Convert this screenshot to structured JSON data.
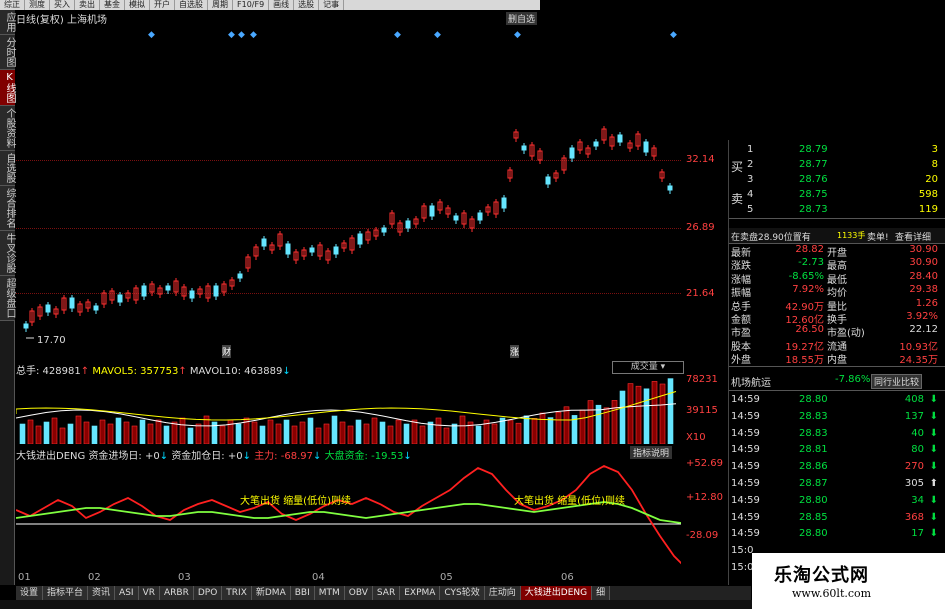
{
  "menu": [
    "综正",
    "测度",
    "买入",
    "卖出",
    "基金",
    "模拟",
    "开户",
    "自选股",
    "周期",
    "F10/F9",
    "画线",
    "选股",
    "记事"
  ],
  "left_tabs": [
    {
      "label": "应用",
      "active": false
    },
    {
      "label": "分时图",
      "active": false
    },
    {
      "label": "K线图",
      "active": true
    },
    {
      "label": "个股资料",
      "active": false
    },
    {
      "label": "自选股",
      "active": false
    },
    {
      "label": "综合排名",
      "active": false
    },
    {
      "label": "牛叉诊股",
      "active": false
    },
    {
      "label": "超级盘口",
      "active": false
    }
  ],
  "chart": {
    "title": "日线(复权) 上海机场",
    "delete_label": "删自选",
    "price_labels": [
      "32.14",
      "26.89",
      "21.64"
    ],
    "low_marker": "17.70",
    "markers": [
      "财",
      "涨"
    ]
  },
  "volume": {
    "total": "总手: 428981",
    "mavol5": "MAVOL5: 357753",
    "mavol10": "MAVOL10: 463889",
    "button": "成交量",
    "labels": [
      "78231",
      "39115",
      "X10"
    ]
  },
  "indicator": {
    "name": "大钱进出DENG",
    "inflow_days": "资金进场日: +0",
    "add_days": "资金加仓日: +0",
    "main": "主力: -68.97",
    "market": "大盘资金: -19.53",
    "button": "指标说明",
    "labels": [
      "+52.69",
      "+12.80",
      "-28.09"
    ],
    "text_a1": "大笔出货",
    "text_a2": "缩量(低位)则续",
    "text_b1": "大笔出货",
    "text_b2": "缩量(低位)则续"
  },
  "x_axis": [
    "01",
    "02",
    "03",
    "04",
    "05",
    "06"
  ],
  "bottom_tabs": [
    "设置",
    "指标平台",
    "资讯",
    "ASI",
    "VR",
    "ARBR",
    "DPO",
    "TRIX",
    "新DMA",
    "BBI",
    "MTM",
    "OBV",
    "SAR",
    "EXPMA",
    "CYS轮效",
    "庄动向",
    "大钱进出DENG",
    "细"
  ],
  "bottom_selected": 16,
  "quote": {
    "sell_label": "卖",
    "buy_label": "买",
    "sell_levels": [
      {
        "n": "1",
        "p": "28.79",
        "v": "3"
      },
      {
        "n": "2",
        "p": "28.77",
        "v": "8"
      },
      {
        "n": "3",
        "p": "28.76",
        "v": "20"
      },
      {
        "n": "4",
        "p": "28.75",
        "v": "598"
      },
      {
        "n": "5",
        "p": "28.73",
        "v": "119"
      }
    ],
    "bar_text": "在卖盘28.90位置有",
    "bar_vol": "1133手",
    "bar_sell": "卖单!",
    "bar_detail": "查看详细",
    "stats": [
      [
        "最新",
        "28.82",
        "开盘",
        "30.90"
      ],
      [
        "涨跌",
        "-2.73",
        "最高",
        "30.90"
      ],
      [
        "涨幅",
        "-8.65%",
        "最低",
        "28.40"
      ],
      [
        "振幅",
        "7.92%",
        "均价",
        "29.38"
      ],
      [
        "总手",
        "42.90万",
        "量比",
        "1.26"
      ],
      [
        "金额",
        "12.60亿",
        "换手",
        "3.92%"
      ],
      [
        "市盈",
        "26.50",
        "市盈(动)",
        "22.12"
      ],
      [
        "股本",
        "19.27亿",
        "流通",
        "10.93亿"
      ],
      [
        "外盘",
        "18.55万",
        "内盘",
        "24.35万"
      ]
    ],
    "sector": "机场航运",
    "sector_chg": "-7.86%",
    "compare_btn": "同行业比较",
    "ticks": [
      {
        "t": "14:59",
        "p": "28.80",
        "v": "408",
        "d": "down"
      },
      {
        "t": "14:59",
        "p": "28.83",
        "v": "137",
        "d": "down"
      },
      {
        "t": "14:59",
        "p": "28.83",
        "v": "40",
        "d": "down"
      },
      {
        "t": "14:59",
        "p": "28.81",
        "v": "80",
        "d": "down"
      },
      {
        "t": "14:59",
        "p": "28.86",
        "v": "270",
        "d": "down"
      },
      {
        "t": "14:59",
        "p": "28.87",
        "v": "305",
        "d": "up"
      },
      {
        "t": "14:59",
        "p": "28.80",
        "v": "34",
        "d": "down"
      },
      {
        "t": "14:59",
        "p": "28.85",
        "v": "368",
        "d": "down"
      },
      {
        "t": "14:59",
        "p": "28.80",
        "v": "17",
        "d": "down"
      },
      {
        "t": "15:0",
        "p": "",
        "v": "",
        "d": ""
      },
      {
        "t": "15:0",
        "p": "",
        "v": "",
        "d": ""
      }
    ]
  },
  "watermark": {
    "cn": "乐淘公式网",
    "url": "www.60lt.com"
  },
  "colors": {
    "up": "#ff4040",
    "down": "#00e040",
    "accent": "#800000",
    "bg": "#000000",
    "cyan": "#00d8ff"
  }
}
